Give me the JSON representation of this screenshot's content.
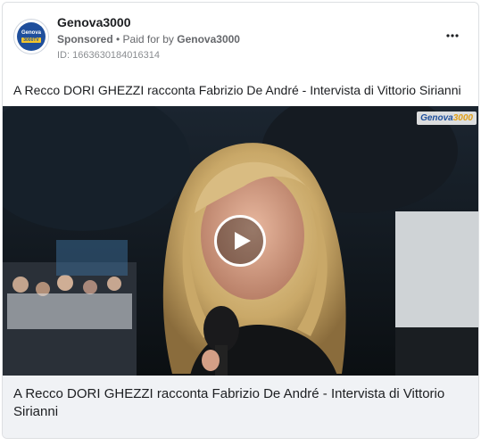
{
  "ad": {
    "page_name": "Genova3000",
    "sponsored_label": "Sponsored",
    "separator": " • ",
    "paid_for_prefix": "Paid for by ",
    "payer": "Genova3000",
    "ad_id": "ID: 1663630184016314",
    "more_icon": "more-horizontal-icon",
    "avatar": {
      "line1": "Genova",
      "line2": "3000TV"
    },
    "body_text": "A Recco DORI GHEZZI racconta Fabrizio De André - Intervista di Vittorio Sirianni",
    "video": {
      "watermark_main": "Genova",
      "watermark_accent": "3000",
      "play_icon": "play-icon"
    },
    "footer_title": "A Recco DORI GHEZZI racconta Fabrizio De André - Intervista di Vittorio Sirianni"
  },
  "colors": {
    "text_primary": "#1c1e21",
    "text_secondary": "#65676b",
    "footer_bg": "#f0f2f5",
    "brand_blue": "#1f4f9c",
    "brand_yellow": "#f3c52b"
  }
}
